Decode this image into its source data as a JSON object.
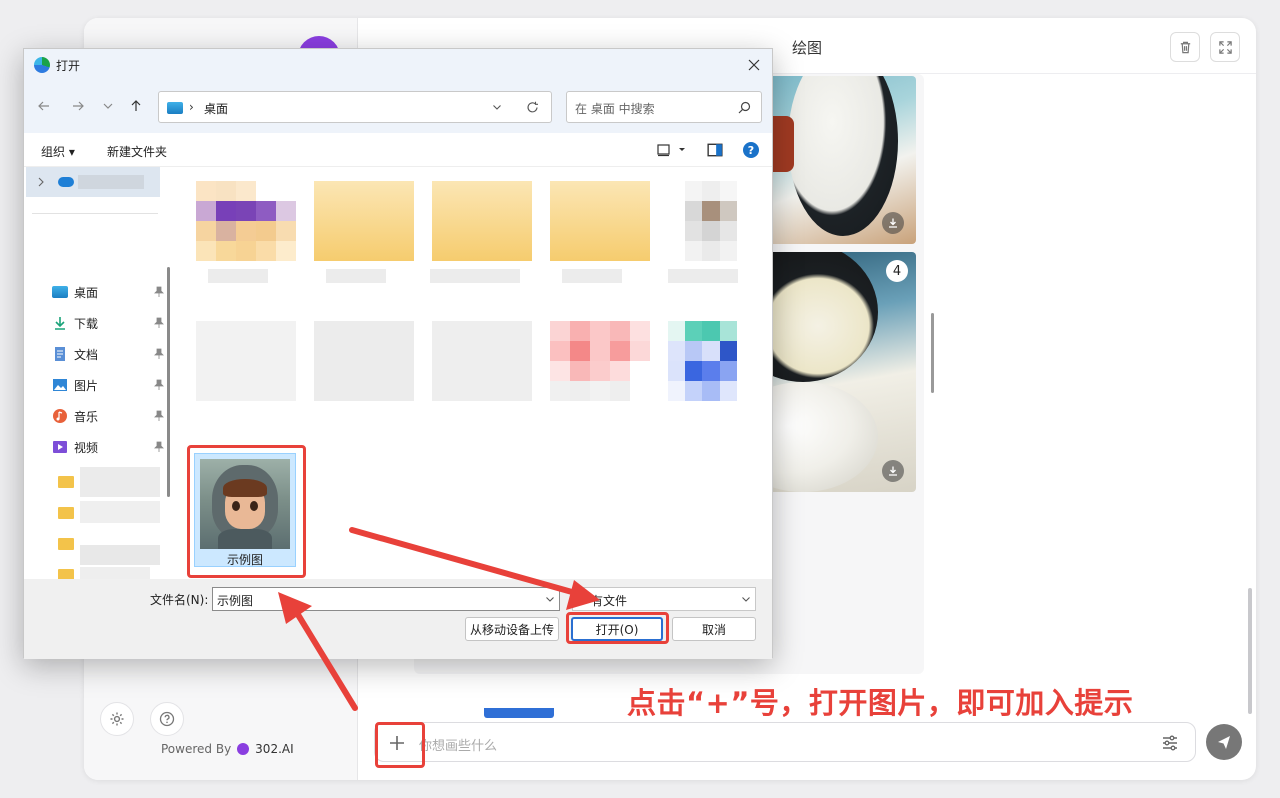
{
  "app": {
    "title": "绘图",
    "powered_by": "Powered By",
    "brand": "302.AI",
    "input_placeholder": "你想画些什么",
    "image_badge": "4"
  },
  "dialog": {
    "title": "打开",
    "address": {
      "separator": "›",
      "location": "桌面"
    },
    "search_placeholder": "在 桌面 中搜索",
    "toolbar": {
      "organize": "组织 ▾",
      "new_folder": "新建文件夹",
      "help": "?"
    },
    "nav_items": [
      {
        "label": "桌面",
        "icon": "desktop-icon"
      },
      {
        "label": "下载",
        "icon": "download-icon"
      },
      {
        "label": "文档",
        "icon": "document-icon"
      },
      {
        "label": "图片",
        "icon": "picture-icon"
      },
      {
        "label": "音乐",
        "icon": "music-icon"
      },
      {
        "label": "视频",
        "icon": "video-icon"
      }
    ],
    "selected_file": "示例图",
    "filename_label": "文件名(N):",
    "filename_value": "示例图",
    "filetype_value": "有文件",
    "upload_button": "从移动设备上传",
    "open_button": "打开(O)",
    "cancel_button": "取消"
  },
  "annotation": {
    "text": "点击“+”号，打开图片，即可加入提示",
    "color": "#e8413a"
  }
}
